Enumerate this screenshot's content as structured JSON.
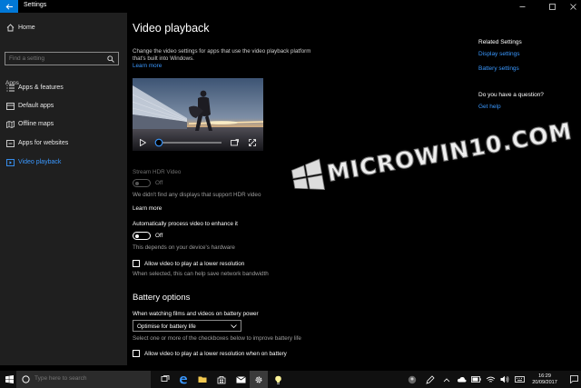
{
  "window": {
    "title": "Settings",
    "back_icon": "back-arrow-icon",
    "controls": [
      "minimize",
      "maximize",
      "close"
    ]
  },
  "sidebar": {
    "home": "Home",
    "search_placeholder": "Find a setting",
    "section": "Apps",
    "items": [
      {
        "label": "Apps & features",
        "icon": "list-icon"
      },
      {
        "label": "Default apps",
        "icon": "default-apps-icon"
      },
      {
        "label": "Offline maps",
        "icon": "map-icon"
      },
      {
        "label": "Apps for websites",
        "icon": "web-icon"
      },
      {
        "label": "Video playback",
        "icon": "video-icon",
        "active": true
      }
    ]
  },
  "main": {
    "title": "Video playback",
    "description": "Change the video settings for apps that use the video playback platform that's built into Windows.",
    "learn_more": "Learn more",
    "hdr": {
      "label": "Stream HDR Video",
      "toggle": "Off",
      "note": "We didn't find any displays that support HDR video",
      "learn_more": "Learn more"
    },
    "enhance": {
      "label": "Automatically process video to enhance it",
      "toggle": "Off",
      "note": "This depends on your device's hardware"
    },
    "lower_res": {
      "label": "Allow video to play at a lower resolution",
      "note": "When selected, this can help save network bandwidth"
    },
    "battery": {
      "title": "Battery options",
      "label": "When watching films and videos on battery power",
      "selected": "Optimise for battery life",
      "note": "Select one or more of the checkboxes below to improve battery life",
      "checkbox": "Allow video to play at a lower resolution when on battery"
    }
  },
  "related": {
    "title": "Related Settings",
    "links": [
      "Display settings",
      "Battery settings"
    ],
    "question": "Do you have a question?",
    "help": "Get help"
  },
  "watermark": {
    "text": "MICROWIN10.COM"
  },
  "taskbar": {
    "search_placeholder": "Type here to search",
    "time": "16:29",
    "date": "20/09/2017"
  },
  "colors": {
    "accent": "#3a98ff",
    "sidebar_bg": "#1f1f1f",
    "main_bg": "#000000",
    "taskbar_bg": "#101010"
  }
}
